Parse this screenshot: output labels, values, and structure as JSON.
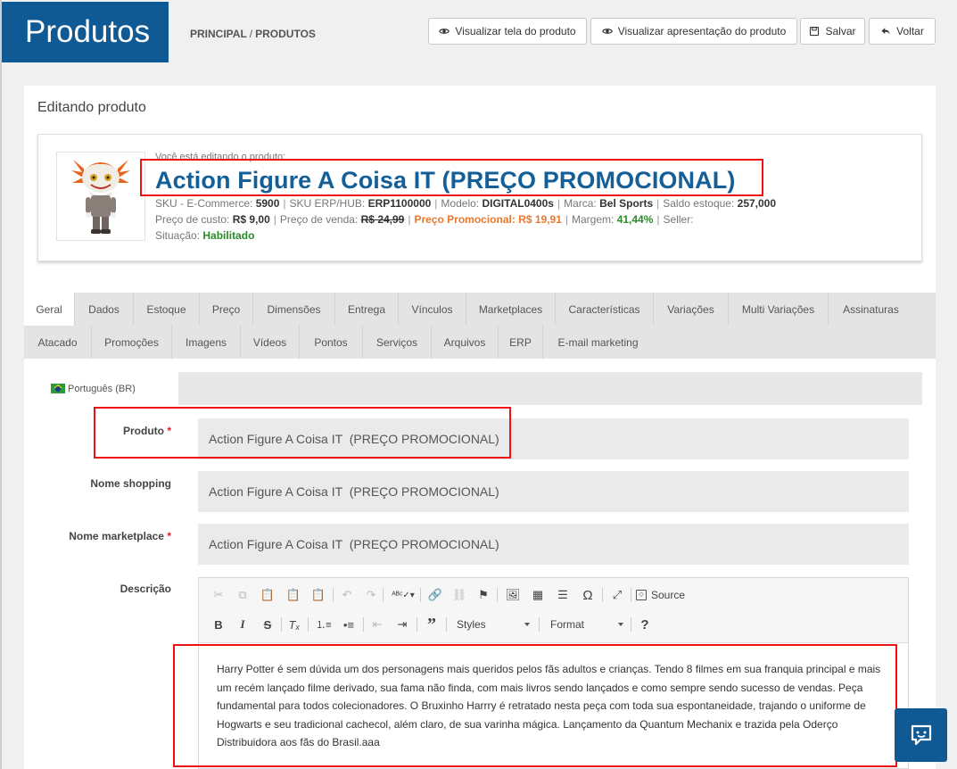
{
  "header": {
    "title": "Produtos",
    "breadcrumb": [
      "PRINCIPAL",
      "/",
      "PRODUTOS"
    ]
  },
  "toolbar": {
    "view_screen": "Visualizar tela do produto",
    "view_presentation": "Visualizar apresentação do produto",
    "save": "Salvar",
    "back": "Voltar"
  },
  "card": {
    "title": "Editando produto"
  },
  "product": {
    "editing_note": "Você está editando o produto:",
    "name": "Action Figure A Coisa IT (PREÇO PROMOCIONAL)",
    "sku_ecommerce_label": "SKU - E-Commerce:",
    "sku_ecommerce": "5900",
    "sku_erp_label": "SKU ERP/HUB:",
    "sku_erp": "ERP1100000",
    "model_label": "Modelo:",
    "model": "DIGITAL0400s",
    "brand_label": "Marca:",
    "brand": "Bel Sports",
    "stock_label": "Saldo estoque:",
    "stock": "257,000",
    "cost_label": "Preço de custo:",
    "cost": "R$ 9,00",
    "sale_label": "Preço de venda:",
    "sale": "R$ 24,99",
    "promo_label": "Preço Promocional:",
    "promo": "R$ 19,91",
    "margin_label": "Margem:",
    "margin": "41,44%",
    "seller_label": "Seller:",
    "status_label": "Situação:",
    "status": "Habilitado"
  },
  "tabs_row1": [
    "Geral",
    "Dados",
    "Estoque",
    "Preço",
    "Dimensões",
    "Entrega",
    "Vínculos",
    "Marketplaces",
    "Características",
    "Variações",
    "Multi Variações",
    "Assinaturas"
  ],
  "tabs_row2": [
    "Atacado",
    "Promoções",
    "Imagens",
    "Vídeos",
    "Pontos",
    "Serviços",
    "Arquivos",
    "ERP",
    "E-mail marketing"
  ],
  "language": {
    "label": "Português (BR)"
  },
  "form": {
    "produto_label": "Produto",
    "produto_value": "Action Figure A Coisa IT  (PREÇO PROMOCIONAL)",
    "shopping_label": "Nome shopping",
    "shopping_value": "Action Figure A Coisa IT  (PREÇO PROMOCIONAL)",
    "marketplace_label": "Nome marketplace",
    "marketplace_value": "Action Figure A Coisa IT  (PREÇO PROMOCIONAL)",
    "descricao_label": "Descrição",
    "required_mark": "*"
  },
  "editor": {
    "source_label": "Source",
    "styles_label": "Styles",
    "format_label": "Format",
    "help": "?",
    "content": "Harry Potter é sem dúvida um dos personagens mais queridos pelos fãs adultos e crianças. Tendo 8 filmes em sua franquia principal e mais um recém lançado filme derivado, sua fama não finda, com mais livros sendo lançados e como sempre sendo sucesso de vendas. Peça fundamental para todos colecionadores. O Bruxinho Harrry é retratado nesta peça com toda sua espontaneidade, trajando o uniforme de Hogwarts e seu tradicional cachecol, além claro, de sua varinha mágica. Lançamento da Quantum Mechanix e trazida pela Oderço Distribuidora aos fãs do Brasil.aaa"
  },
  "colors": {
    "brand": "#0f5a94",
    "title": "#145f97",
    "promo": "#e8782d",
    "ok": "#2a8a2a",
    "highlight": "#e11111"
  }
}
